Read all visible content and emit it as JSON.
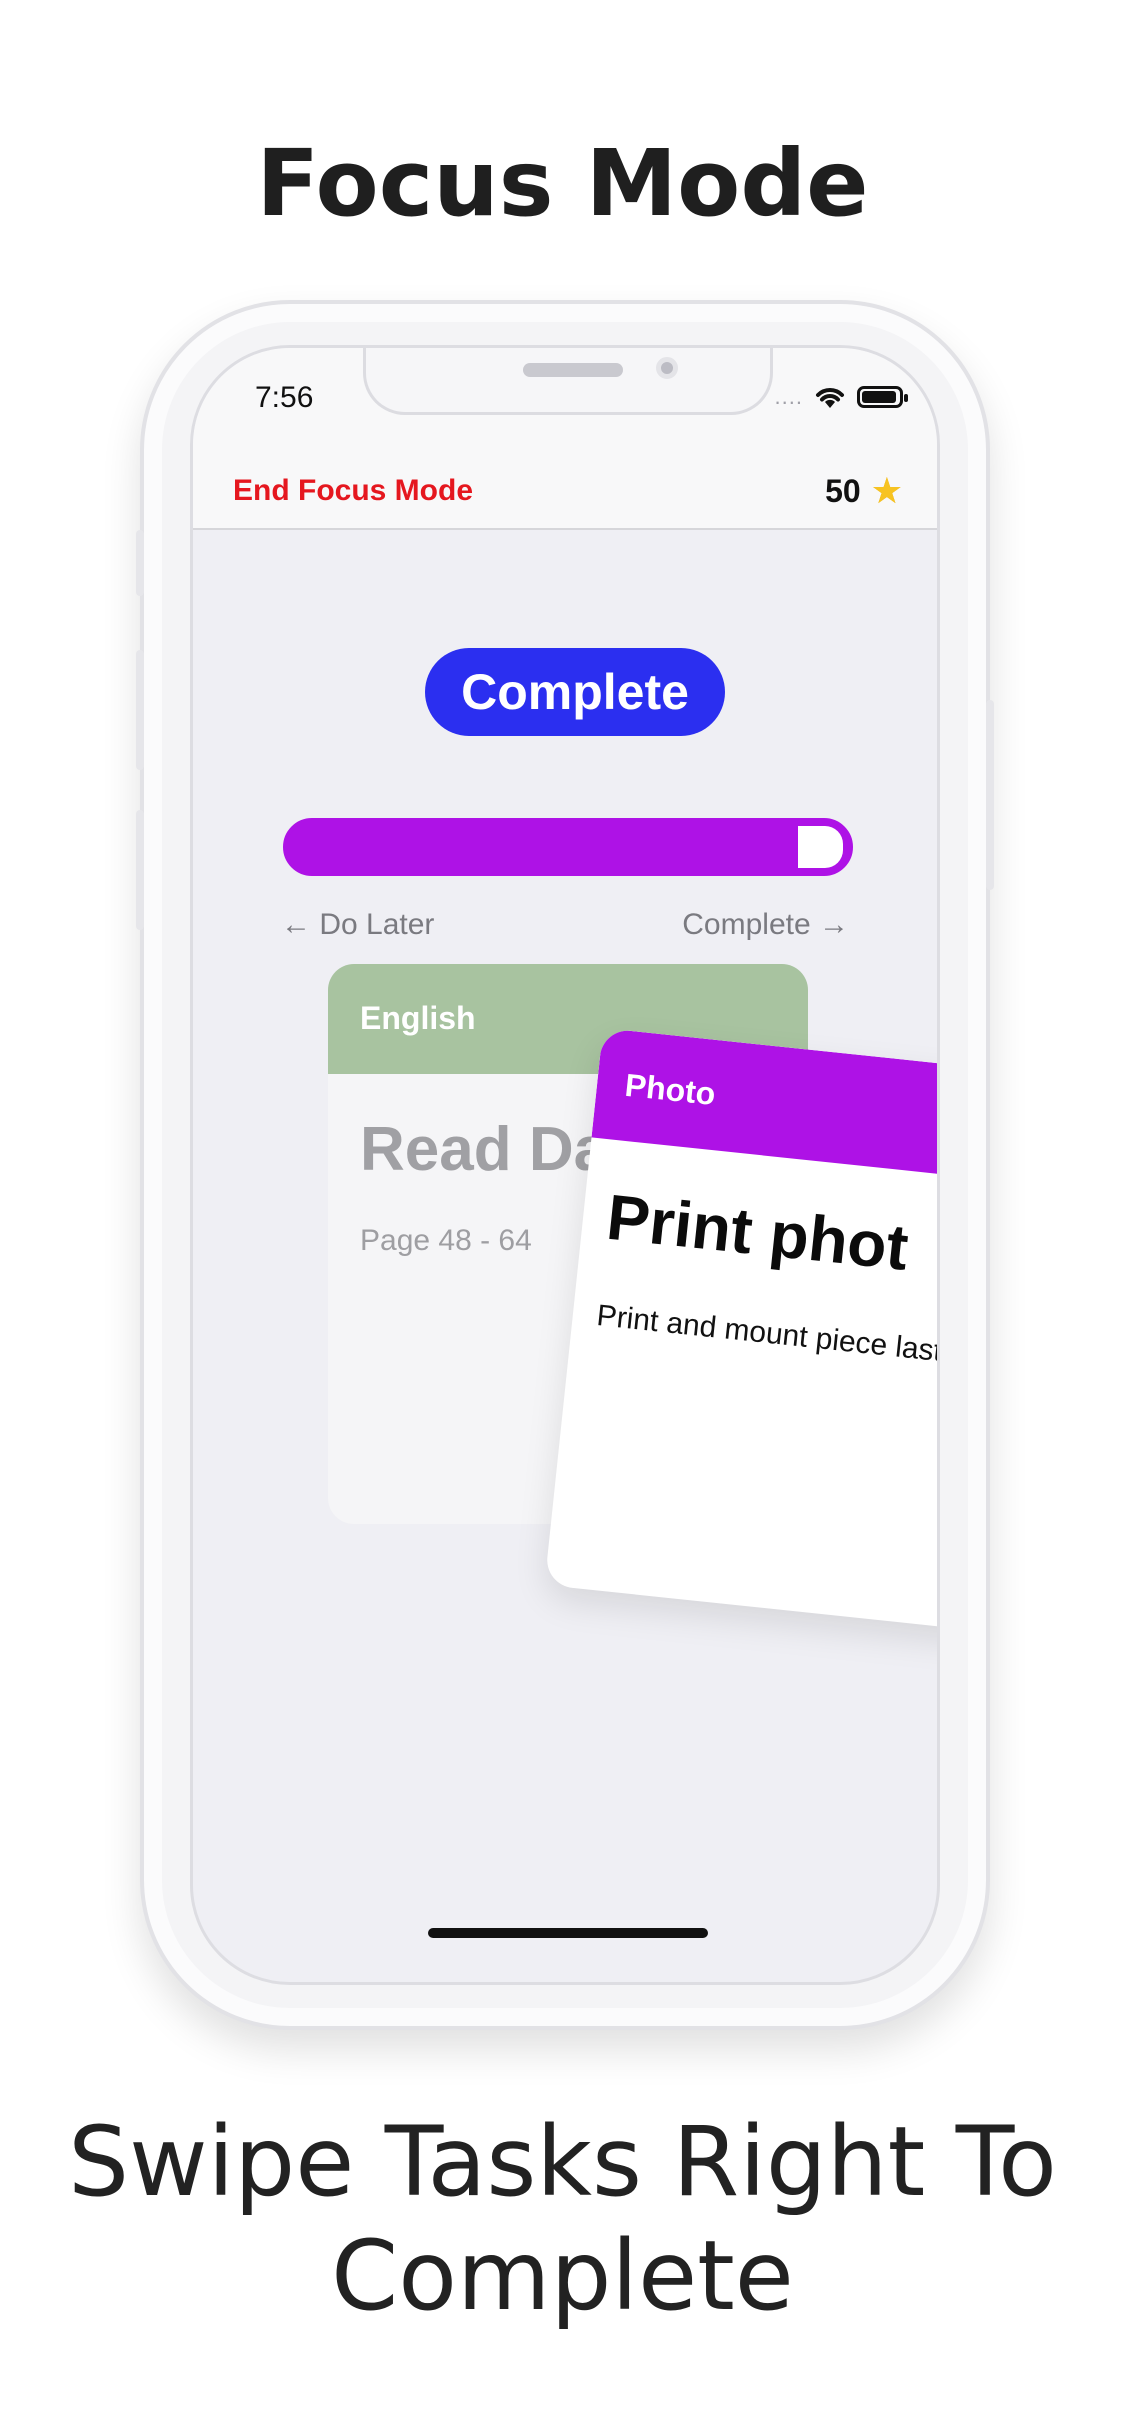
{
  "marketing": {
    "headline": "Focus Mode",
    "caption_line1": "Swipe Tasks Right To",
    "caption_line2": "Complete"
  },
  "status_bar": {
    "time": "7:56",
    "signal_dots": "....",
    "wifi_icon": "wifi-icon",
    "battery_icon": "battery-icon"
  },
  "nav": {
    "end_focus_label": "End Focus Mode",
    "score": "50",
    "score_icon": "star-icon"
  },
  "focus": {
    "action_label": "Complete",
    "action_color": "#2b2ff0",
    "progress_color": "#ae12e6",
    "progress_remaining_fraction": 0.08,
    "hint_left": "← Do Later",
    "hint_right": "Complete →"
  },
  "cards": [
    {
      "subject": "English",
      "color": "#a8c3a0",
      "title": "Read Dalle",
      "description": "Page 48 - 64"
    },
    {
      "subject": "Photo",
      "color": "#ae12e6",
      "title": "Print phot",
      "description": "Print and mount piece last week"
    }
  ]
}
